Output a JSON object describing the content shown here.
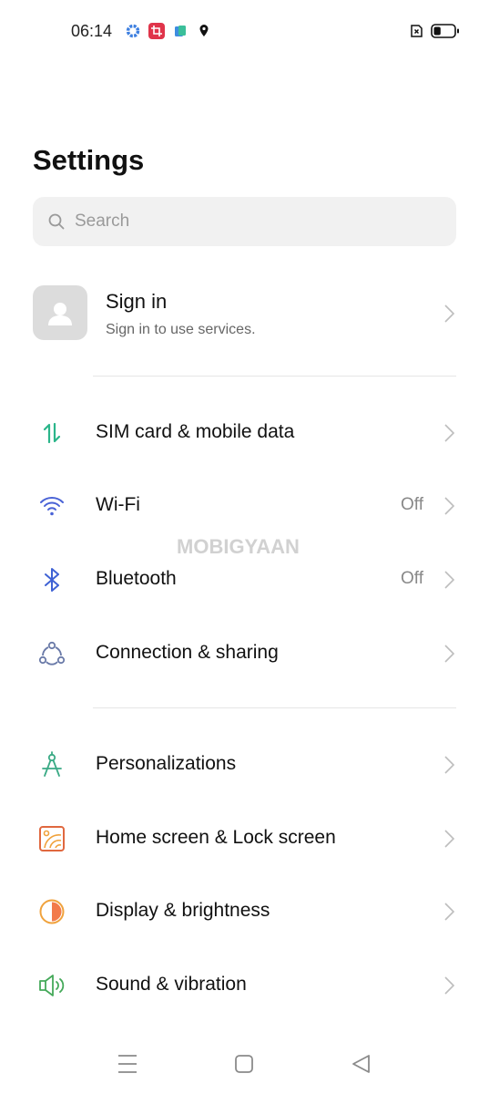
{
  "status_bar": {
    "time": "06:14",
    "icons": [
      "settings-notification-icon",
      "crop-app-icon",
      "files-app-icon",
      "location-icon",
      "no-sim-icon",
      "battery-icon"
    ],
    "battery_level": 0.35
  },
  "header": {
    "title": "Settings"
  },
  "search": {
    "placeholder": "Search"
  },
  "account": {
    "title": "Sign in",
    "subtitle": "Sign in to use services."
  },
  "watermark": "MOBIGYAAN",
  "sections": [
    {
      "items": [
        {
          "label": "SIM card & mobile data",
          "icon": "mobile-data-icon",
          "color": "#2bb58a",
          "value": ""
        },
        {
          "label": "Wi-Fi",
          "icon": "wifi-icon",
          "color": "#4a63d6",
          "value": "Off"
        },
        {
          "label": "Bluetooth",
          "icon": "bluetooth-icon",
          "color": "#3f62d4",
          "value": "Off"
        },
        {
          "label": "Connection & sharing",
          "icon": "connection-sharing-icon",
          "color": "#6a7aa8",
          "value": ""
        }
      ]
    },
    {
      "items": [
        {
          "label": "Personalizations",
          "icon": "compass-icon",
          "color": "#3aaa85",
          "value": ""
        },
        {
          "label": "Home screen & Lock screen",
          "icon": "wallpaper-icon",
          "color": "#e0683f",
          "value": ""
        },
        {
          "label": "Display & brightness",
          "icon": "brightness-icon",
          "color": "#f0a23c",
          "value": ""
        },
        {
          "label": "Sound & vibration",
          "icon": "speaker-icon",
          "color": "#45a95a",
          "value": ""
        }
      ]
    }
  ],
  "navigation": {
    "buttons": [
      "menu-button",
      "home-button",
      "back-button"
    ]
  }
}
